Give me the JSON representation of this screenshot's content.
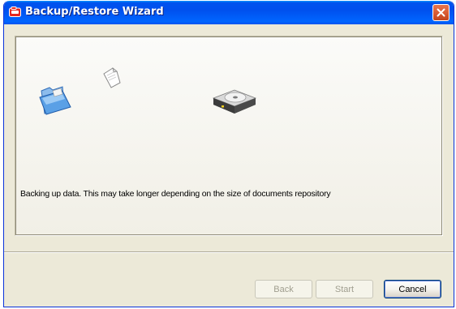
{
  "window": {
    "title": "Backup/Restore Wizard",
    "title_icon": "app-red-icon",
    "close_icon": "close-icon"
  },
  "content": {
    "status_message": "Backing up data. This may take longer depending on the size of documents repository",
    "icons": [
      "open-folder-icon",
      "document-icon",
      "hard-drive-icon"
    ]
  },
  "buttons": {
    "back_label": "Back",
    "start_label": "Start",
    "cancel_label": "Cancel",
    "back_enabled": false,
    "start_enabled": false,
    "cancel_enabled": true
  },
  "colors": {
    "titlebar": "#0053ee",
    "window_body": "#ece9d8",
    "close_button": "#d85a33"
  }
}
